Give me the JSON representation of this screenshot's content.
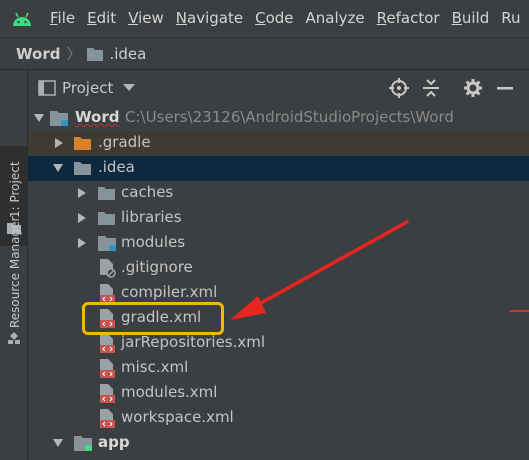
{
  "menu": {
    "items": [
      {
        "mnemonic": "F",
        "rest": "ile"
      },
      {
        "mnemonic": "E",
        "rest": "dit"
      },
      {
        "mnemonic": "V",
        "rest": "iew"
      },
      {
        "mnemonic": "N",
        "rest": "avigate"
      },
      {
        "mnemonic": "C",
        "rest": "ode"
      },
      {
        "mnemonic": "",
        "rest": "Analyze"
      },
      {
        "mnemonic": "R",
        "rest": "efactor"
      },
      {
        "mnemonic": "B",
        "rest": "uild"
      },
      {
        "mnemonic": "",
        "rest": "Ru"
      }
    ]
  },
  "breadcrumb": {
    "project": "Word",
    "folder": ".idea"
  },
  "leftstrip": {
    "project_tab": "1: Project",
    "resource_tab": "Resource Manager"
  },
  "panel": {
    "title": "Project"
  },
  "tree": {
    "root_name": "Word",
    "root_path": "C:\\Users\\23126\\AndroidStudioProjects\\Word",
    "gradle_dir": ".gradle",
    "idea_dir": ".idea",
    "caches": "caches",
    "libraries": "libraries",
    "modules_dir": "modules",
    "gitignore": ".gitignore",
    "compiler": "compiler.xml",
    "gradle_xml": "gradle.xml",
    "jar_repos": "jarRepositories.xml",
    "misc": "misc.xml",
    "modules_xml": "modules.xml",
    "workspace": "workspace.xml",
    "app": "app"
  },
  "colors": {
    "accent_highlight": "#f5b800",
    "annotation_arrow": "#e8251e",
    "selection": "#0d293e",
    "folder": "#87939a",
    "gradle_folder": "#d9822b"
  }
}
